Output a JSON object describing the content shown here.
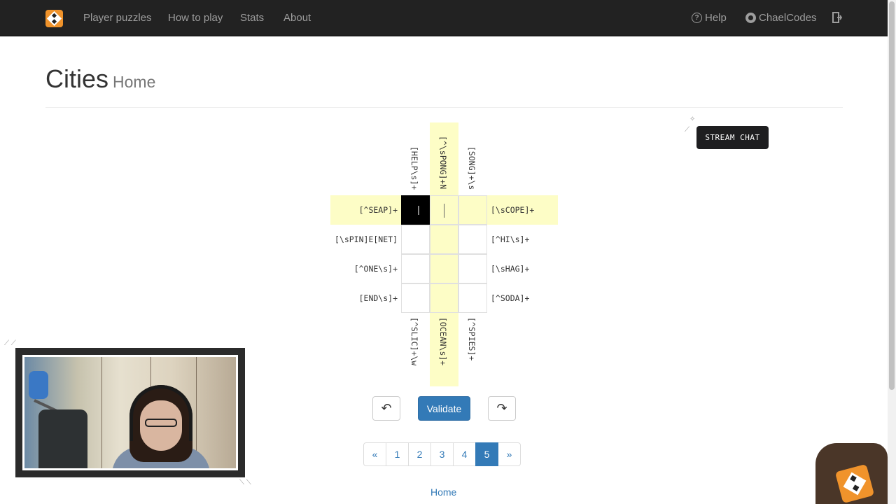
{
  "nav": {
    "items": [
      "Player puzzles",
      "How to play",
      "Stats",
      "About"
    ],
    "right": {
      "help": "Help",
      "github": "ChaelCodes"
    }
  },
  "header": {
    "title": "Cities",
    "subtitle": "Home"
  },
  "puzzle": {
    "top_clues": [
      "[HELP\\s]+",
      "[^\\sPONG]+N",
      "[SONG]+\\s"
    ],
    "bottom_clues": [
      "[^SLIC]+\\w",
      "[OCEAN\\s]+",
      "[^SPIES]+"
    ],
    "left_clues": [
      "[^SEAP]+",
      "[\\sPIN]E[NET]",
      "[^ONE\\s]+",
      "[END\\s]+"
    ],
    "right_clues": [
      "[\\sCOPE]+",
      "[^HI\\s]+",
      "[\\sHAG]+",
      "[^SODA]+"
    ]
  },
  "controls": {
    "undo": "↶",
    "validate": "Validate",
    "redo": "↷"
  },
  "pagination": {
    "prev": "«",
    "pages": [
      "1",
      "2",
      "3",
      "4",
      "5"
    ],
    "active": "5",
    "next": "»"
  },
  "footer": {
    "home_link": "Home"
  },
  "overlay": {
    "stream_chat": "STREAM CHAT"
  },
  "colors": {
    "navbar": "#222222",
    "highlight": "#fdfdc6",
    "primary": "#337ab7",
    "brand": "#f0932b"
  },
  "icons": [
    "help-icon",
    "github-icon",
    "logout-icon",
    "undo-icon",
    "redo-icon"
  ]
}
